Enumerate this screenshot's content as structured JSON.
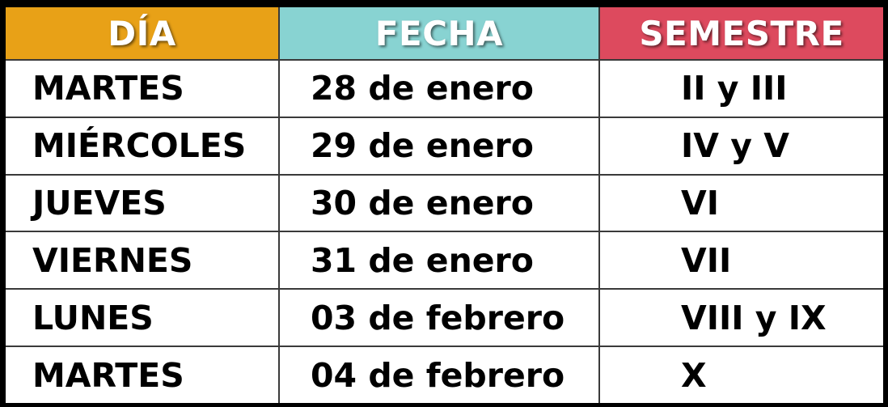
{
  "table": {
    "headers": [
      {
        "label": "DÍA",
        "color": "#E8A117"
      },
      {
        "label": "FECHA",
        "color": "#88D3D2"
      },
      {
        "label": "SEMESTRE",
        "color": "#DD4A5E"
      }
    ],
    "rows": [
      {
        "day": "MARTES",
        "date": "28 de enero",
        "semester": "II y III"
      },
      {
        "day": "MIÉRCOLES",
        "date": "29 de enero",
        "semester": "IV y V"
      },
      {
        "day": "JUEVES",
        "date": "30 de enero",
        "semester": "VI"
      },
      {
        "day": "VIERNES",
        "date": "31 de enero",
        "semester": "VII"
      },
      {
        "day": "LUNES",
        "date": "03 de febrero",
        "semester": "VIII y IX"
      },
      {
        "day": "MARTES",
        "date": "04 de febrero",
        "semester": "X"
      }
    ]
  }
}
